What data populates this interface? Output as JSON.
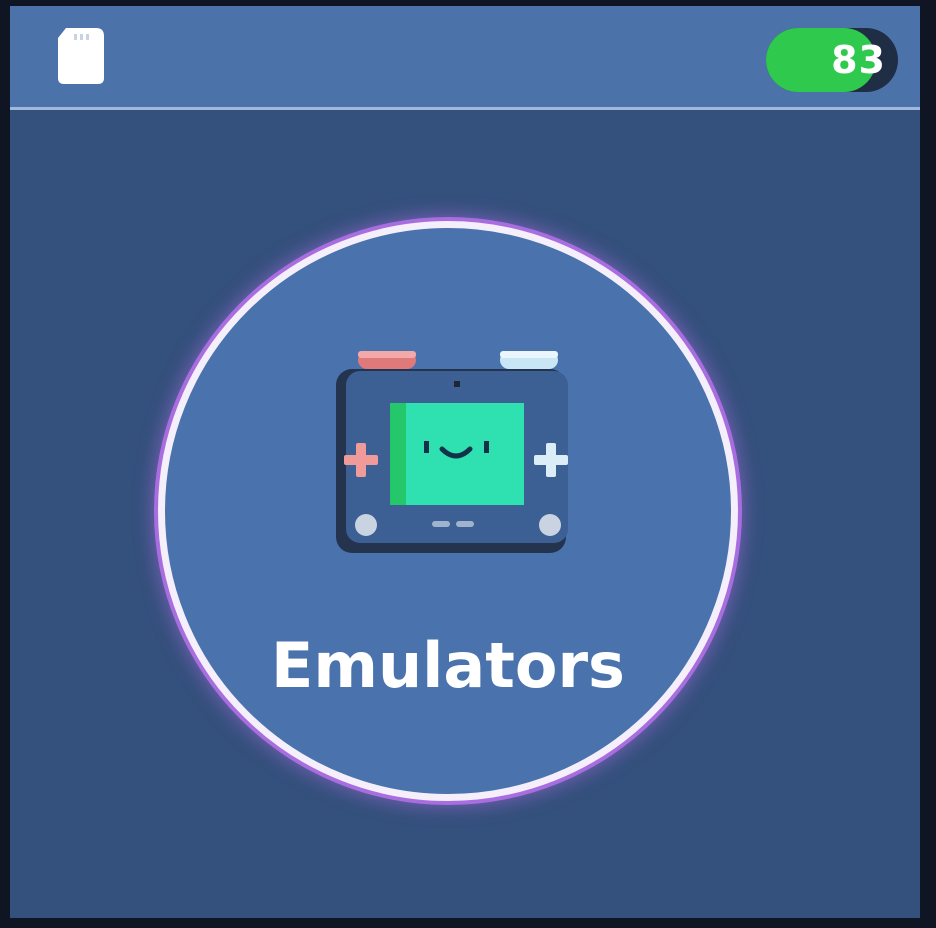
{
  "status_bar": {
    "storage_icon": "sd-card-icon",
    "battery": {
      "percent": 83,
      "label": "83",
      "color": "#2ec94d"
    }
  },
  "menu": {
    "selected_item": {
      "label": "Emulators",
      "icon": "handheld-console-icon",
      "highlight_color": "#a86ee0"
    }
  },
  "colors": {
    "background": "#34507c",
    "top_bar": "#4c73a9",
    "item_fill": "#4a72ac"
  }
}
